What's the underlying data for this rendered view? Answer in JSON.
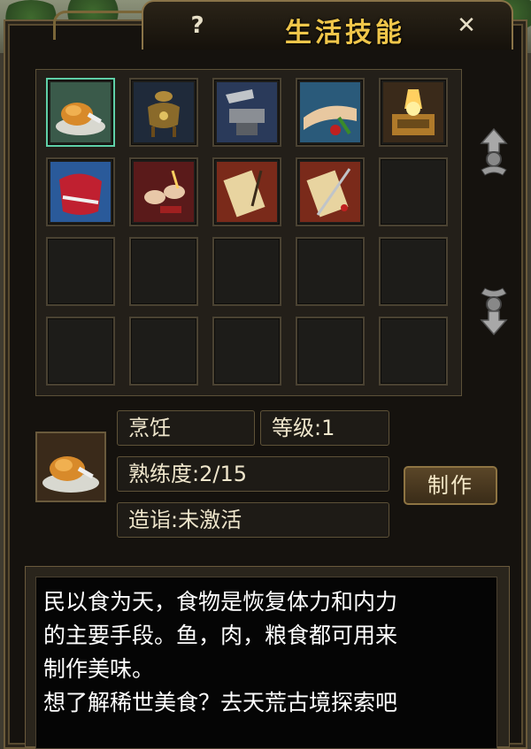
{
  "window": {
    "title": "生活技能",
    "help_label": "?",
    "close_label": "✕"
  },
  "skills": [
    {
      "name": "cooking-icon",
      "selected": true
    },
    {
      "name": "alchemy-icon",
      "selected": false
    },
    {
      "name": "forging-icon",
      "selected": false
    },
    {
      "name": "herb-gathering-icon",
      "selected": false
    },
    {
      "name": "treasure-box-icon",
      "selected": false
    },
    {
      "name": "tailoring-icon",
      "selected": false
    },
    {
      "name": "crafting-hands-icon",
      "selected": false
    },
    {
      "name": "scroll-brush-icon",
      "selected": false
    },
    {
      "name": "scroll-sword-icon",
      "selected": false
    }
  ],
  "detail": {
    "skill_name": "烹饪",
    "level": "等级:1",
    "proficiency": "熟练度:2/15",
    "mastery": "造诣:未激活",
    "make_button": "制作"
  },
  "description": [
    "民以食为天，食物是恢复体力和内力",
    "的主要手段。鱼，肉，粮食都可用来",
    "制作美味。",
    "想了解稀世美食？去天荒古境探索吧"
  ]
}
